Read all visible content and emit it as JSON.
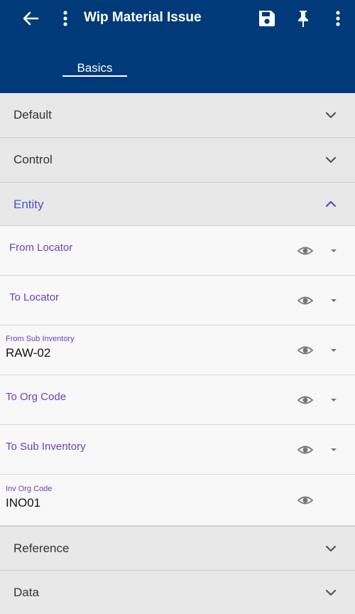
{
  "app_bar": {
    "title": "Wip Material Issue",
    "icons": [
      "back-arrow-icon",
      "more-vert-icon",
      "save-icon",
      "pin-icon",
      "more-vert-icon"
    ]
  },
  "tabs": [
    {
      "label": "Basics",
      "active": true
    }
  ],
  "sections": {
    "default": {
      "label": "Default",
      "expanded": false
    },
    "control": {
      "label": "Control",
      "expanded": false
    },
    "entity": {
      "label": "Entity",
      "expanded": true
    },
    "reference": {
      "label": "Reference",
      "expanded": false
    },
    "data": {
      "label": "Data",
      "expanded": false
    }
  },
  "entity_fields": [
    {
      "label": "From Locator",
      "value": ""
    },
    {
      "label": "To Locator",
      "value": ""
    },
    {
      "label": "From Sub Inventory",
      "value": "RAW-02"
    },
    {
      "label": "To Org Code",
      "value": ""
    },
    {
      "label": "To Sub Inventory",
      "value": ""
    },
    {
      "label": "Inv Org Code",
      "value": "INO01"
    }
  ],
  "colors": {
    "app_bar": "#003a78",
    "section_bg": "#e8e8e8",
    "field_bg": "#f8f8f8",
    "field_label": "#6a3fc4",
    "expanded_section_label": "#4a55c4"
  }
}
